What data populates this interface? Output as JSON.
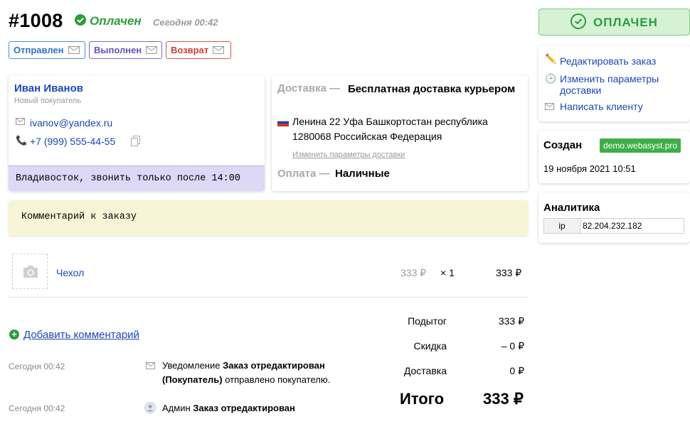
{
  "header": {
    "order_number": "#1008",
    "status": "Оплачен",
    "status_time": "Сегодня 00:42"
  },
  "workflow_buttons": [
    {
      "label": "Отправлен",
      "color": "#2b74c9"
    },
    {
      "label": "Выполнен",
      "color": "#6a4fc0"
    },
    {
      "label": "Возврат",
      "color": "#d23a33"
    }
  ],
  "customer": {
    "name": "Иван Иванов",
    "type": "Новый покупатель",
    "email": "ivanov@yandex.ru",
    "phone": "+7 (999) 555-44-55",
    "note": "Владивосток, звонить только после 14:00"
  },
  "shipping": {
    "label": "Доставка —",
    "method": "Бесплатная доставка курьером",
    "address_line1": "Ленина 22 Уфа Башкортостан республика",
    "address_line2": "1280068 Российская Федерация",
    "edit_link": "Изменить параметры доставки",
    "payment_label": "Оплата —",
    "payment_method": "Наличные"
  },
  "order_comment": "Комментарий к заказу",
  "items": [
    {
      "name": "Чехол",
      "price": "333 ₽",
      "qty": "× 1",
      "total": "333 ₽"
    }
  ],
  "totals": {
    "subtotal_label": "Подытог",
    "subtotal": "333 ₽",
    "discount_label": "Скидка",
    "discount": "– 0 ₽",
    "shipping_label": "Доставка",
    "shipping": "0 ₽",
    "total_label": "Итого",
    "total": "333 ₽"
  },
  "timeline": {
    "add_comment": "Добавить комментарий",
    "entries": [
      {
        "time": "Сегодня 00:42",
        "prefix": "Уведомление",
        "bold1": "Заказ отредактирован (Покупатель)",
        "suffix": "отправлено покупателю."
      },
      {
        "time": "Сегодня 00:42",
        "prefix": "Админ",
        "bold1": "Заказ отредактирован",
        "suffix": ""
      }
    ]
  },
  "sidebar": {
    "paid_label": "ОПЛАЧЕН",
    "actions": [
      "Редактировать заказ",
      "Изменить параметры доставки",
      "Написать клиенту"
    ],
    "created_title": "Создан",
    "created_source": "demo.webasyst.pro",
    "created_date": "19 ноября 2021 10:51",
    "analytics_title": "Аналитика",
    "analytics_key": "ip",
    "analytics_value": "82.204.232.182"
  },
  "colors": {
    "accent_green": "#2a9d3a",
    "link_blue": "#1a47b8",
    "note_lilac": "#dcd8f5",
    "comment_yellow": "#f6f6d6"
  }
}
